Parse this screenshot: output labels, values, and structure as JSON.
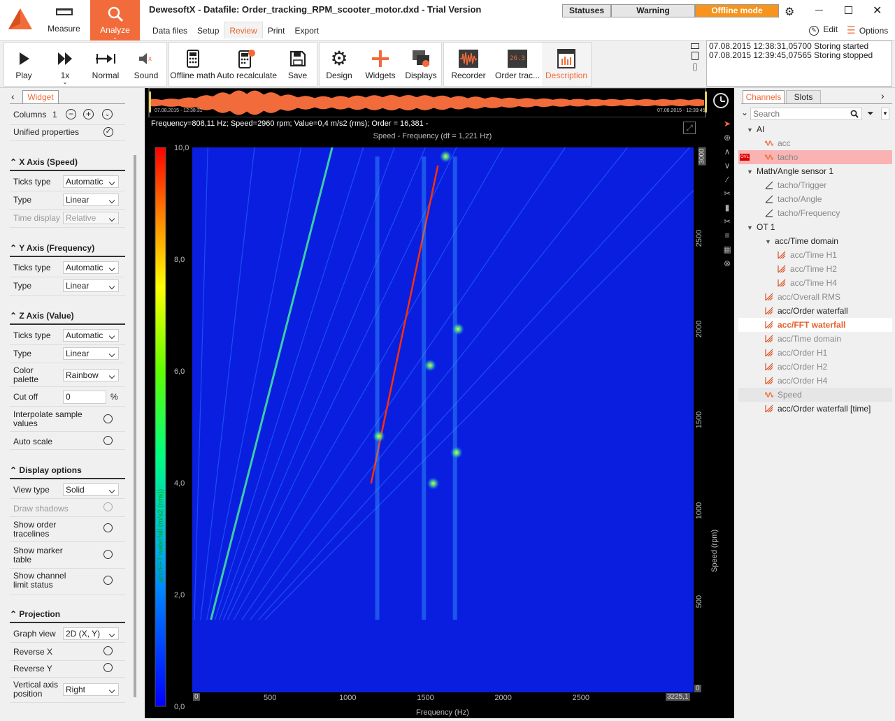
{
  "app": {
    "title": "DewesoftX - Datafile: Order_tracking_RPM_scooter_motor.dxd - Trial Version",
    "measure_label": "Measure",
    "analyze_label": "Analyze",
    "menu": [
      "Data files",
      "Setup",
      "Review",
      "Print",
      "Export"
    ],
    "statuses_label": "Statuses",
    "warning_label": "Warning",
    "offline_label": "Offline mode",
    "edit_label": "Edit",
    "options_label": "Options",
    "accent": "#f26b3a"
  },
  "toolbar": {
    "play": "Play",
    "speed": "1x",
    "normal": "Normal",
    "sound": "Sound",
    "offline_math": "Offline math",
    "auto_recalculate": "Auto recalculate",
    "save": "Save",
    "design": "Design",
    "widgets": "Widgets",
    "displays": "Displays",
    "recorder": "Recorder",
    "order_tracking": "Order trac...",
    "description": "Description",
    "order_value": "26.3"
  },
  "log": {
    "line1": "07.08.2015 12:38:31,05700 Storing started",
    "line2": "07.08.2015 12:39:45,07565 Storing stopped"
  },
  "overview": {
    "left_time": "07.08.2015 - 12:38:31",
    "right_time": "07.08.2015 - 12:39:45"
  },
  "left_panel": {
    "tab": "Widget",
    "columns_label": "Columns",
    "columns_value": "1",
    "unified_label": "Unified properties",
    "x_axis_title": "X Axis (Speed)",
    "y_axis_title": "Y Axis (Frequency)",
    "z_axis_title": "Z Axis (Value)",
    "display_title": "Display options",
    "projection_title": "Projection",
    "ticks_type": "Ticks type",
    "type": "Type",
    "time_display": "Time display",
    "automatic": "Automatic",
    "linear": "Linear",
    "relative": "Relative",
    "color_palette": "Color palette",
    "rainbow": "Rainbow",
    "cut_off": "Cut off",
    "cut_off_value": "0",
    "percent": "%",
    "interpolate": "Interpolate sample values",
    "auto_scale": "Auto scale",
    "view_type": "View type",
    "solid": "Solid",
    "draw_shadows": "Draw shadows",
    "show_order": "Show order tracelines",
    "show_marker": "Show marker table",
    "show_limit": "Show channel limit status",
    "graph_view": "Graph view",
    "graph_view_value": "2D (X, Y)",
    "reverse_x": "Reverse X",
    "reverse_y": "Reverse Y",
    "vertical_axis": "Vertical axis position",
    "right": "Right"
  },
  "graph": {
    "info": "Frequency=808,11 Hz; Speed=2960 rpm; Value=0,4 m/s2 (rms); Order = 16,381 -",
    "title": "Speed - Frequency (df = 1,221 Hz)",
    "x_label": "Frequency (Hz)",
    "y_label": "Speed (rpm)",
    "z_label": "acc/FFT waterfall (m/s2 (rms))",
    "x_end_label": "3225,1",
    "y_end_label": "3000",
    "y_start_label": "0",
    "x_start_label": "0"
  },
  "chart_data": {
    "type": "heatmap",
    "title": "Speed - Frequency (df = 1,221 Hz)",
    "xlabel": "Frequency (Hz)",
    "ylabel": "Speed (rpm)",
    "zlabel": "acc/FFT waterfall (m/s2 (rms))",
    "xlim": [
      0,
      3225.1
    ],
    "ylim": [
      0,
      3000
    ],
    "zlim": [
      0,
      10
    ],
    "x_ticks": [
      "500",
      "1000",
      "1500",
      "2000",
      "2500"
    ],
    "x_tick_values": [
      500,
      1000,
      1500,
      2000,
      2500
    ],
    "y_ticks": [
      "500",
      "1000",
      "1500",
      "2000",
      "2500"
    ],
    "y_tick_values": [
      500,
      1000,
      1500,
      2000,
      2500
    ],
    "z_ticks": [
      "0,0",
      "2,0",
      "4,0",
      "6,0",
      "8,0",
      "10,0"
    ],
    "z_tick_values": [
      0,
      2,
      4,
      6,
      8,
      10
    ],
    "palette": "Rainbow",
    "grid": false
  },
  "right_panel": {
    "tabs": [
      "Channels",
      "Slots"
    ],
    "search_placeholder": "Search",
    "tree": [
      {
        "label": "AI",
        "level": 0,
        "kind": "group"
      },
      {
        "label": "acc",
        "level": 1,
        "kind": "wave",
        "dim": true
      },
      {
        "label": "tacho",
        "level": 1,
        "kind": "wave",
        "dim": true,
        "ovl": true
      },
      {
        "label": "Math/Angle sensor 1",
        "level": 0,
        "kind": "group"
      },
      {
        "label": "tacho/Trigger",
        "level": 1,
        "kind": "math",
        "dim": true
      },
      {
        "label": "tacho/Angle",
        "level": 1,
        "kind": "math",
        "dim": true
      },
      {
        "label": "tacho/Frequency",
        "level": 1,
        "kind": "math",
        "dim": true
      },
      {
        "label": "OT 1",
        "level": 0,
        "kind": "group"
      },
      {
        "label": "acc/Time domain",
        "level": 1,
        "kind": "group"
      },
      {
        "label": "acc/Time H1",
        "level": 2,
        "kind": "ot",
        "dim": true
      },
      {
        "label": "acc/Time H2",
        "level": 2,
        "kind": "ot",
        "dim": true
      },
      {
        "label": "acc/Time H4",
        "level": 2,
        "kind": "ot",
        "dim": true
      },
      {
        "label": "acc/Overall RMS",
        "level": 1,
        "kind": "ot",
        "dim": true
      },
      {
        "label": "acc/Order waterfall",
        "level": 1,
        "kind": "ot"
      },
      {
        "label": "acc/FFT waterfall",
        "level": 1,
        "kind": "ot",
        "selected": true
      },
      {
        "label": "acc/Time domain",
        "level": 1,
        "kind": "ot",
        "dim": true
      },
      {
        "label": "acc/Order H1",
        "level": 1,
        "kind": "ot",
        "dim": true
      },
      {
        "label": "acc/Order H2",
        "level": 1,
        "kind": "ot",
        "dim": true
      },
      {
        "label": "acc/Order H4",
        "level": 1,
        "kind": "ot",
        "dim": true
      },
      {
        "label": "Speed",
        "level": 1,
        "kind": "wave",
        "dim": true,
        "hl": true
      },
      {
        "label": "acc/Order waterfall [time]",
        "level": 1,
        "kind": "ot"
      }
    ],
    "ovl_label": "OVL"
  }
}
